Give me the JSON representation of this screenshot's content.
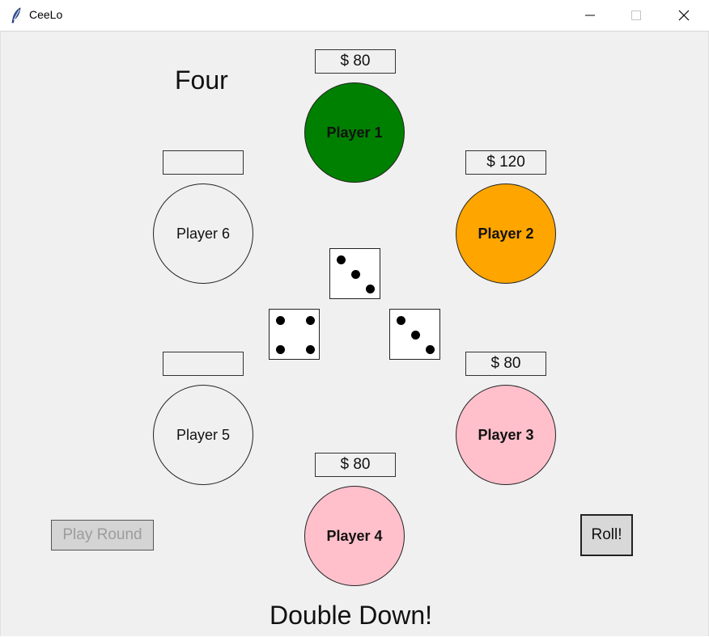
{
  "window": {
    "title": "CeeLo",
    "icons": {
      "app": "feather-icon",
      "minimize": "minimize-icon",
      "maximize": "maximize-icon",
      "close": "close-icon"
    }
  },
  "game": {
    "roll_result": "Four",
    "status_message": "Double Down!",
    "play_round_label": "Play Round",
    "roll_label": "Roll!"
  },
  "players": [
    {
      "name": "Player 1",
      "money": "$ 80",
      "color": "#008000",
      "active": true
    },
    {
      "name": "Player 2",
      "money": "$ 120",
      "color": "#ffa500",
      "active": true
    },
    {
      "name": "Player 3",
      "money": "$ 80",
      "color": "#ffc0cb",
      "active": true
    },
    {
      "name": "Player 4",
      "money": "$ 80",
      "color": "#ffc0cb",
      "active": true
    },
    {
      "name": "Player 5",
      "money": "",
      "color": "#f0f0f0",
      "active": false
    },
    {
      "name": "Player 6",
      "money": "",
      "color": "#f0f0f0",
      "active": false
    }
  ],
  "dice": [
    3,
    4,
    3
  ]
}
